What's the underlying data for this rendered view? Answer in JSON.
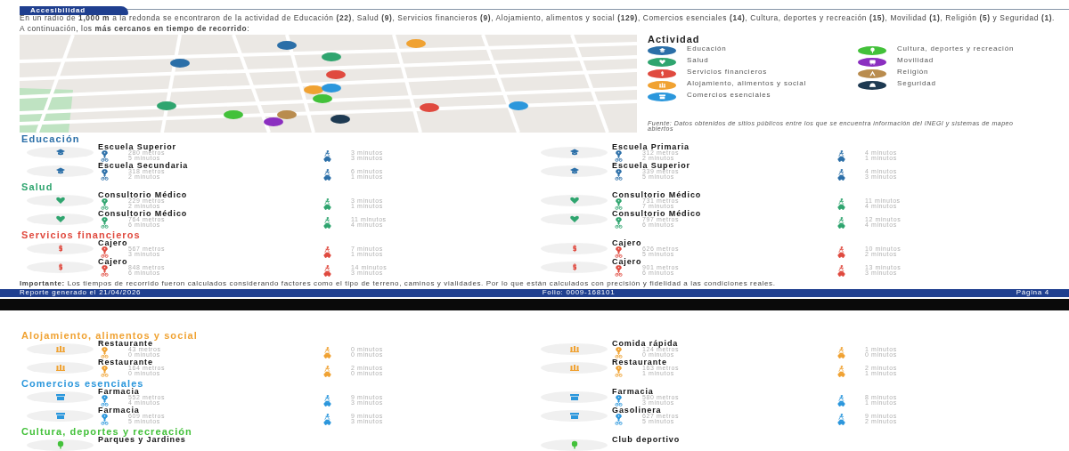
{
  "header": {
    "tab": "Accesibilidad"
  },
  "summary": "En un radio de **1,000 m** a la redonda se encontraron de la actividad de Educación **(22)**, Salud **(9)**, Servicios financieros **(9)**, Alojamiento, alimentos y social **(129)**, Comercios esenciales **(14)**, Cultura, deportes y recreación **(15)**, Movilidad **(1)**, Religión **(5)** y Seguridad **(1)**.",
  "intro": "A continuación, los **más cercanos en tiempo de recorrido**:",
  "legend": {
    "title": "Actividad",
    "items": [
      {
        "label": "Educación",
        "kind": "education",
        "color": "#2b6fa8"
      },
      {
        "label": "Salud",
        "kind": "health",
        "color": "#2fa56f"
      },
      {
        "label": "Servicios financieros",
        "kind": "finance",
        "color": "#e04a3f"
      },
      {
        "label": "Alojamiento, alimentos y social",
        "kind": "lodging",
        "color": "#f0a232"
      },
      {
        "label": "Comercios esenciales",
        "kind": "commerce",
        "color": "#2b97dc"
      },
      {
        "label": "Cultura, deportes y recreación",
        "kind": "culture",
        "color": "#43c13a"
      },
      {
        "label": "Movilidad",
        "kind": "mobility",
        "color": "#8b2fc0"
      },
      {
        "label": "Religión",
        "kind": "religion",
        "color": "#b98c4e"
      },
      {
        "label": "Seguridad",
        "kind": "security",
        "color": "#1e3a52"
      }
    ],
    "source": "Fuente: Datos obtenidos de sitios públicos entre los que se encuentra información del INEGI y sistemas de mapeo abiertos"
  },
  "sections": [
    {
      "title": "Educación",
      "kind": "education",
      "color": "#2b6fa8",
      "items": [
        {
          "name": "Escuela Superior",
          "distance": "280 metros",
          "bike": "5 minutos",
          "walk": "3 minutos",
          "car": "3 minutos"
        },
        {
          "name": "Escuela Primaria",
          "distance": "312 metros",
          "bike": "2 minutos",
          "walk": "4 minutos",
          "car": "1 minutos"
        },
        {
          "name": "Escuela Secundaria",
          "distance": "318 metros",
          "bike": "2 minutos",
          "walk": "6 minutos",
          "car": "1 minutos"
        },
        {
          "name": "Escuela Superior",
          "distance": "339 metros",
          "bike": "5 minutos",
          "walk": "4 minutos",
          "car": "3 minutos"
        }
      ]
    },
    {
      "title": "Salud",
      "kind": "health",
      "color": "#2fa56f",
      "items": [
        {
          "name": "Consultorio Médico",
          "distance": "229 metros",
          "bike": "2 minutos",
          "walk": "3 minutos",
          "car": "1 minutos"
        },
        {
          "name": "Consultorio Médico",
          "distance": "731 metros",
          "bike": "7 minutos",
          "walk": "11 minutos",
          "car": "4 minutos"
        },
        {
          "name": "Consultorio Médico",
          "distance": "764 metros",
          "bike": "6 minutos",
          "walk": "11 minutos",
          "car": "4 minutos"
        },
        {
          "name": "Consultorio Médico",
          "distance": "797 metros",
          "bike": "6 minutos",
          "walk": "12 minutos",
          "car": "4 minutos"
        }
      ]
    },
    {
      "title": "Servicios financieros",
      "kind": "finance",
      "color": "#e04a3f",
      "items": [
        {
          "name": "Cajero",
          "distance": "567 metros",
          "bike": "3 minutos",
          "walk": "7 minutos",
          "car": "1 minutos"
        },
        {
          "name": "Cajero",
          "distance": "626 metros",
          "bike": "5 minutos",
          "walk": "10 minutos",
          "car": "2 minutos"
        },
        {
          "name": "Cajero",
          "distance": "848 metros",
          "bike": "6 minutos",
          "walk": "14 minutos",
          "car": "3 minutos"
        },
        {
          "name": "Cajero",
          "distance": "901 metros",
          "bike": "6 minutos",
          "walk": "13 minutos",
          "car": "3 minutos"
        }
      ]
    }
  ],
  "note": "**Importante:** Los tiempos de recorrido fueron calculados considerando factores como el tipo de terreno, caminos y vialidades. Por lo que están calculados con precisión y fidelidad a las condiciones reales.",
  "footer": {
    "generated": "Reporte generado el 21/04/2026",
    "folio": "Folio: 0009-168101",
    "page": "Página 4"
  },
  "sections_next": [
    {
      "title": "Alojamiento, alimentos y social",
      "kind": "lodging",
      "color": "#f0a232",
      "items": [
        {
          "name": "Restaurante",
          "distance": "43 metros",
          "bike": "0 minutos",
          "walk": "0 minutos",
          "car": "0 minutos"
        },
        {
          "name": "Comida rápida",
          "distance": "124 metros",
          "bike": "0 minutos",
          "walk": "1 minutos",
          "car": "0 minutos"
        },
        {
          "name": "Restaurante",
          "distance": "164 metros",
          "bike": "0 minutos",
          "walk": "2 minutos",
          "car": "0 minutos"
        },
        {
          "name": "Restaurante",
          "distance": "163 metros",
          "bike": "1 minutos",
          "walk": "2 minutos",
          "car": "1 minutos"
        }
      ]
    },
    {
      "title": "Comercios esenciales",
      "kind": "commerce",
      "color": "#2b97dc",
      "items": [
        {
          "name": "Farmacia",
          "distance": "552 metros",
          "bike": "4 minutos",
          "walk": "9 minutos",
          "car": "3 minutos"
        },
        {
          "name": "Farmacia",
          "distance": "580 metros",
          "bike": "3 minutos",
          "walk": "8 minutos",
          "car": "1 minutos"
        },
        {
          "name": "Farmacia",
          "distance": "609 metros",
          "bike": "5 minutos",
          "walk": "9 minutos",
          "car": "3 minutos"
        },
        {
          "name": "Gasolinera",
          "distance": "627 metros",
          "bike": "5 minutos",
          "walk": "9 minutos",
          "car": "2 minutos"
        }
      ]
    },
    {
      "title": "Cultura, deportes y recreación",
      "kind": "culture",
      "color": "#43c13a",
      "items": [
        {
          "name": "Parques y Jardines"
        },
        {
          "name": "Club deportivo"
        }
      ]
    }
  ]
}
